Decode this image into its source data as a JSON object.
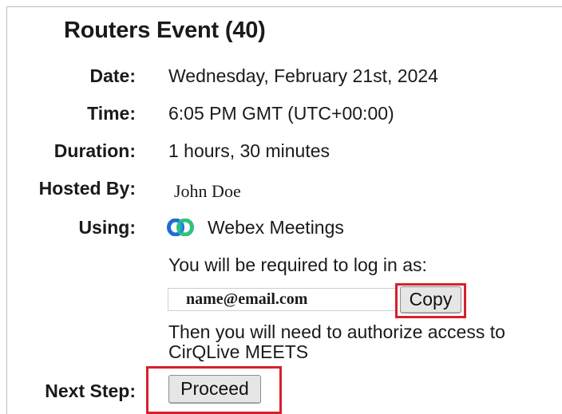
{
  "event": {
    "title": "Routers Event (40)"
  },
  "fields": {
    "date_label": "Date:",
    "date_value": "Wednesday, February 21st, 2024",
    "time_label": "Time:",
    "time_value": "6:05 PM GMT (UTC+00:00)",
    "duration_label": "Duration:",
    "duration_value": "1 hours, 30 minutes",
    "hosted_by_label": "Hosted By:",
    "hosted_by_value": "John Doe",
    "using_label": "Using:",
    "using_value": "Webex Meetings",
    "using_icon": "webex-logo-icon"
  },
  "login": {
    "instruction": "You will be required to log in as:",
    "email": "name@email.com",
    "copy_label": "Copy",
    "authorize_line1": "Then you will need to authorize access to",
    "authorize_line2": "CirQLive MEETS"
  },
  "next_step": {
    "label": "Next Step:",
    "proceed_label": "Proceed"
  },
  "colors": {
    "highlight": "#d6202c",
    "button_bg": "#e6e6e6",
    "webex_blue": "#1f6bd8",
    "webex_green": "#2ec27e"
  }
}
